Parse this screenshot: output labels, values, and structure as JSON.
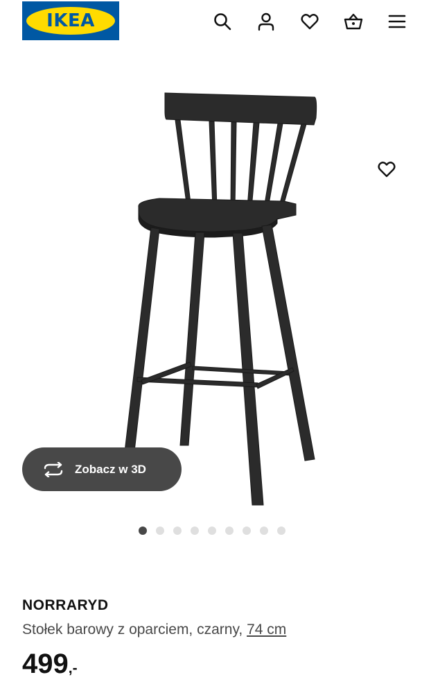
{
  "header": {
    "logo_text": "IKEA",
    "logo_reg": "®",
    "icons": [
      "search-icon",
      "account-icon",
      "heart-icon",
      "basket-icon",
      "menu-icon"
    ]
  },
  "colors": {
    "brand_blue": "#0058a3",
    "brand_yellow": "#ffdb00",
    "dark_button": "#484848",
    "dot_inactive": "#dfdfdf"
  },
  "gallery": {
    "view3d_label": "Zobacz w 3D",
    "image_count": 9,
    "active_index": 0
  },
  "product": {
    "name": "NORRARYD",
    "description": "Stołek barowy z oparciem, czarny, ",
    "size_link": "74 cm",
    "price_integer": "499",
    "price_suffix": ",-"
  }
}
